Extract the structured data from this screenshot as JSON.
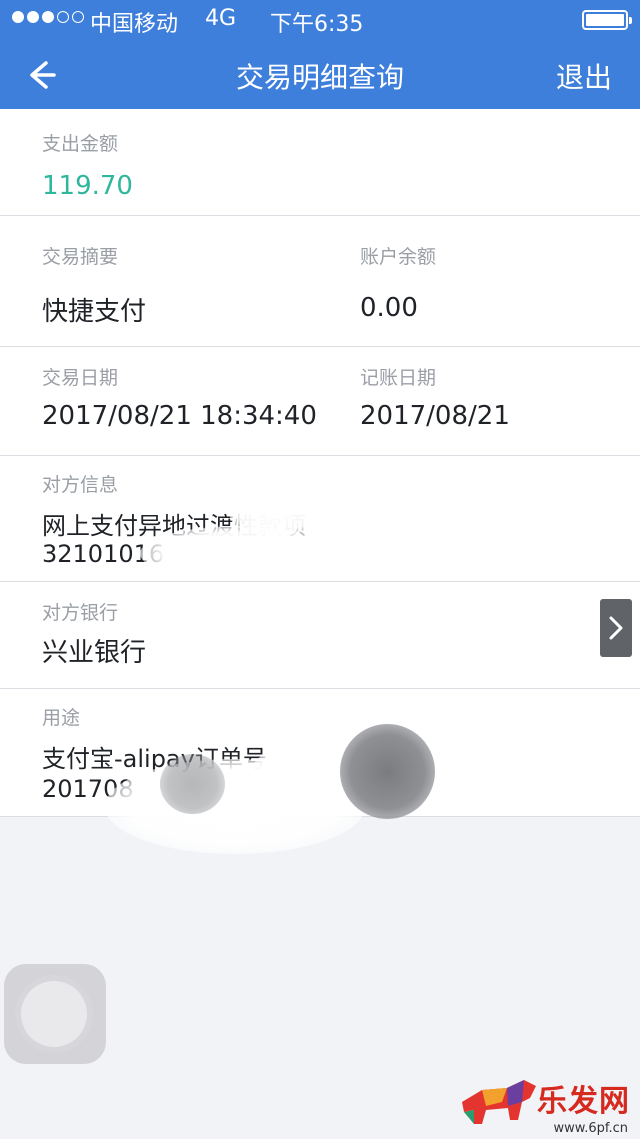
{
  "status_bar": {
    "carrier": "中国移动",
    "network": "4G",
    "time": "下午6:35"
  },
  "nav": {
    "title": "交易明细查询",
    "exit_label": "退出",
    "back_icon": "back-arrow-icon"
  },
  "details": {
    "expense_amount_label": "支出金额",
    "expense_amount": "119.70",
    "summary_label": "交易摘要",
    "summary": "快捷支付",
    "balance_label": "账户余额",
    "balance": "0.00",
    "trade_date_label": "交易日期",
    "trade_date": "2017/08/21 18:34:40",
    "post_date_label": "记账日期",
    "post_date": "2017/08/21",
    "counterparty_label": "对方信息",
    "counterparty_name": "网上支付异地过渡性款项",
    "counterparty_account": "32101016",
    "counterparty_bank_label": "对方银行",
    "counterparty_bank": "兴业银行",
    "purpose_label": "用途",
    "purpose": "支付宝-alipay订单号",
    "purpose_order": "201708"
  },
  "watermark": {
    "brand": "乐发网",
    "url": "www.6pf.cn"
  },
  "colors": {
    "header_blue": "#3f7fdc",
    "amount_green": "#2fb79d",
    "background": "#f1f3f7"
  }
}
